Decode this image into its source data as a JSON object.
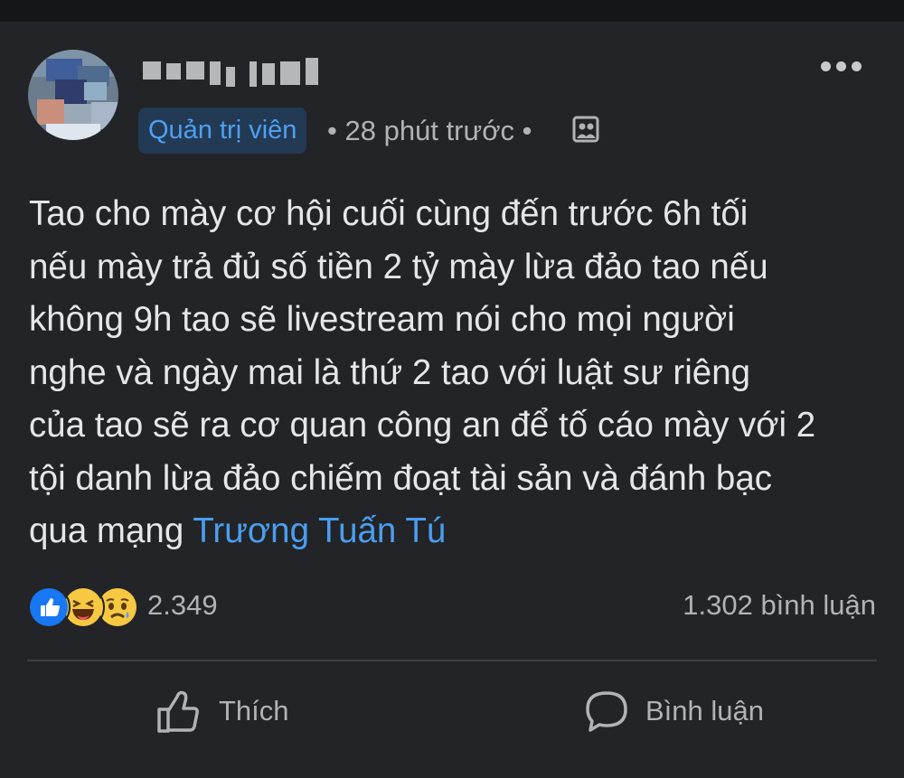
{
  "post": {
    "author_name": "",
    "role_badge": "Quản trị viên",
    "timestamp": "28 phút trước",
    "separator": "•",
    "lines": [
      "Tao cho mày cơ hội cuối cùng đến trước 6h tối",
      "nếu mày trả đủ số tiền 2 tỷ mày lừa đảo tao nếu",
      "không 9h tao sẽ livestream nói cho mọi người",
      "nghe và ngày mai là thứ 2 tao với luật sư riêng",
      "của tao sẽ ra cơ quan công an để tố cáo mày với 2",
      "tội danh lừa đảo chiếm đoạt tài sản và đánh bạc"
    ],
    "last_line_prefix": "qua mạng ",
    "mention": "Trương Tuấn Tú"
  },
  "stats": {
    "reaction_count": "2.349",
    "comment_count": "1.302 bình luận",
    "reactions": [
      "like-icon",
      "haha-icon",
      "sad-icon"
    ]
  },
  "actions": {
    "like_label": "Thích",
    "comment_label": "Bình luận"
  },
  "colors": {
    "background": "#232427",
    "accent": "#4a9ef0",
    "badge_bg": "#233a55",
    "muted_text": "#b0b3b8"
  }
}
